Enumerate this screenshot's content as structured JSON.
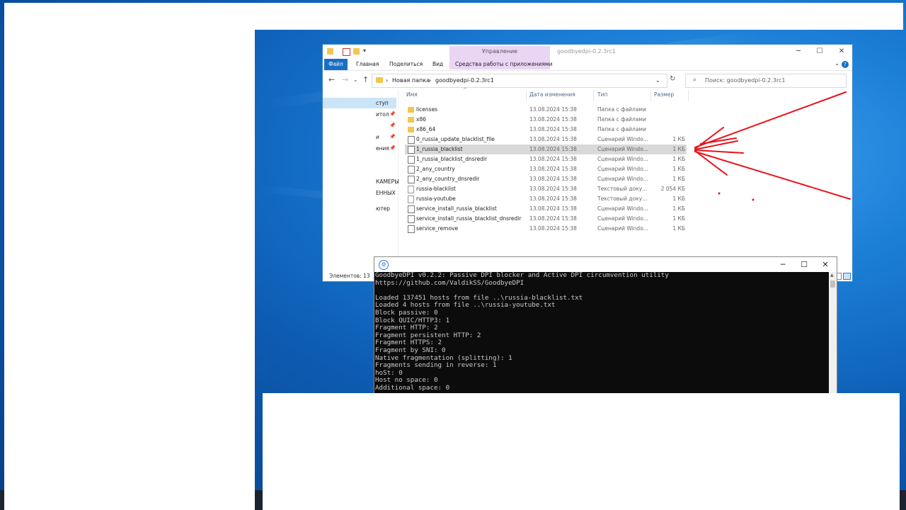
{
  "explorer": {
    "ribbon": {
      "context_group": "Управление",
      "title": "goodbyedpi-0.2.3rc1",
      "tabs": [
        "Файл",
        "Главная",
        "Поделиться",
        "Вид",
        "Средства работы с приложениями"
      ]
    },
    "address": {
      "crumbs": [
        "Новая папка",
        "goodbyedpi-0.2.3rc1"
      ],
      "search_placeholder": "Поиск: goodbyedpi-0.2.3rc1"
    },
    "nav_items": [
      "ступ",
      "итол",
      "и",
      "ения",
      "КАМЕРЫ",
      "ЕННЫХ",
      "ютер"
    ],
    "columns": [
      "Имя",
      "Дата изменения",
      "Тип",
      "Размер"
    ],
    "files": [
      {
        "name": "licenses",
        "date": "13.08.2024 15:38",
        "type": "Папка с файлами",
        "size": "",
        "icon": "folder"
      },
      {
        "name": "x86",
        "date": "13.08.2024 15:38",
        "type": "Папка с файлами",
        "size": "",
        "icon": "folder"
      },
      {
        "name": "x86_64",
        "date": "13.08.2024 15:38",
        "type": "Папка с файлами",
        "size": "",
        "icon": "folder"
      },
      {
        "name": "0_russia_update_blacklist_file",
        "date": "13.08.2024 15:38",
        "type": "Сценарий Windo...",
        "size": "1 КБ",
        "icon": "bat"
      },
      {
        "name": "1_russia_blacklist",
        "date": "13.08.2024 15:38",
        "type": "Сценарий Windo...",
        "size": "1 КБ",
        "icon": "bat"
      },
      {
        "name": "1_russia_blacklist_dnsredir",
        "date": "13.08.2024 15:38",
        "type": "Сценарий Windo...",
        "size": "1 КБ",
        "icon": "bat"
      },
      {
        "name": "2_any_country",
        "date": "13.08.2024 15:38",
        "type": "Сценарий Windo...",
        "size": "1 КБ",
        "icon": "bat"
      },
      {
        "name": "2_any_country_dnsredir",
        "date": "13.08.2024 15:38",
        "type": "Сценарий Windo...",
        "size": "1 КБ",
        "icon": "bat"
      },
      {
        "name": "russia-blacklist",
        "date": "13.08.2024 15:38",
        "type": "Текстовый доку...",
        "size": "2 054 КБ",
        "icon": "txt"
      },
      {
        "name": "russia-youtube",
        "date": "13.08.2024 15:38",
        "type": "Текстовый доку...",
        "size": "1 КБ",
        "icon": "txt"
      },
      {
        "name": "service_install_russia_blacklist",
        "date": "13.08.2024 15:38",
        "type": "Сценарий Windo...",
        "size": "1 КБ",
        "icon": "bat"
      },
      {
        "name": "service_install_russia_blacklist_dnsredir",
        "date": "13.08.2024 15:38",
        "type": "Сценарий Windo...",
        "size": "1 КБ",
        "icon": "bat"
      },
      {
        "name": "service_remove",
        "date": "13.08.2024 15:38",
        "type": "Сценарий Windo...",
        "size": "1 КБ",
        "icon": "bat"
      }
    ],
    "selected_file": "1_russia_blacklist",
    "status": "Элементов: 13"
  },
  "console": {
    "lines": [
      "GoodbyeDPI v0.2.2: Passive DPI blocker and Active DPI circumvention utility",
      "https://github.com/ValdikSS/GoodbyeDPI",
      "",
      "Loaded 137451 hosts from file ..\\russia-blacklist.txt",
      "Loaded 4 hosts from file ..\\russia-youtube.txt",
      "Block passive: 0",
      "Block QUIC/HTTP3: 1",
      "Fragment HTTP: 2",
      "Fragment persistent HTTP: 2",
      "Fragment HTTPS: 2",
      "Fragment by SNI: 0",
      "Native fragmentation (splitting): 1",
      "Fragments sending in reverse: 1",
      "hoSt: 0",
      "Host no space: 0",
      "Additional space: 0"
    ]
  },
  "colors": {
    "annotation_arrows": "#e8141b",
    "accent": "#1a6fc4",
    "context_tab": "#ead5f5"
  }
}
